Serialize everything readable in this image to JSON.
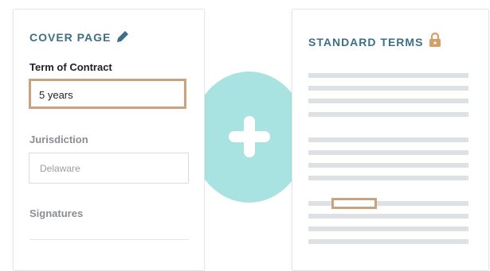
{
  "cover_page": {
    "title": "COVER PAGE",
    "edit_icon": "pencil-icon",
    "term_label": "Term of Contract",
    "term_value": "5 years",
    "jurisdiction_label": "Jurisdiction",
    "jurisdiction_value": "Delaware",
    "signatures_label": "Signatures"
  },
  "center": {
    "icon": "plus-icon"
  },
  "standard_terms": {
    "title": "STANDARD TERMS",
    "lock_icon": "lock-icon"
  },
  "colors": {
    "heading": "#3d6f87",
    "highlight_border": "#c9a27e",
    "circle": "#a9e3e1",
    "text_line": "#dde1e4"
  }
}
